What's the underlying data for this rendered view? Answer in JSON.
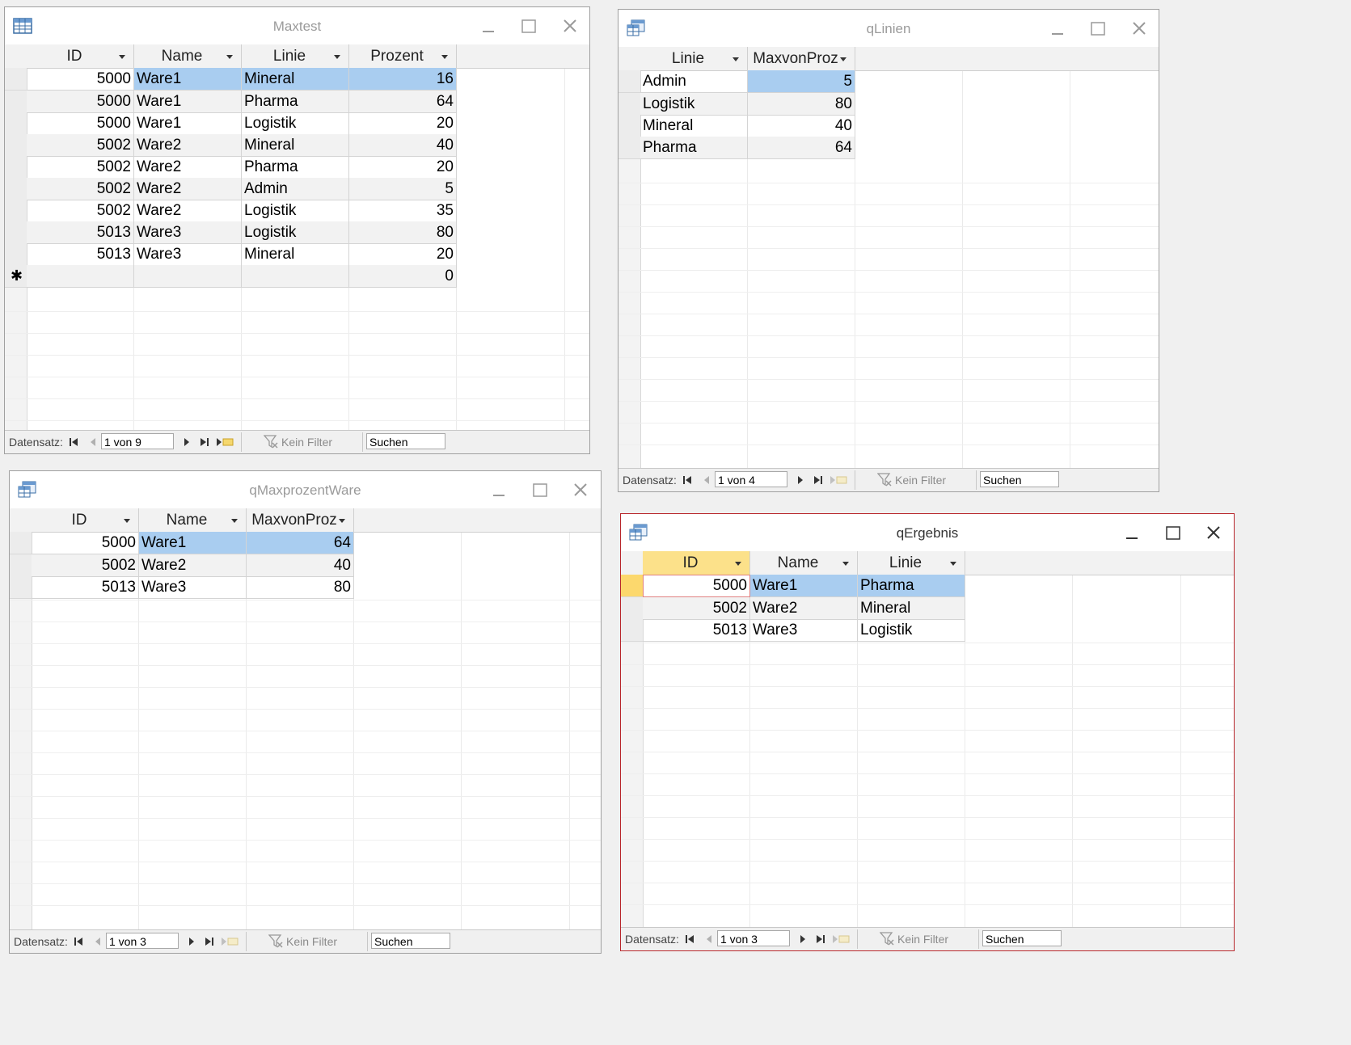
{
  "windows": {
    "maxtest": {
      "title": "Maxtest",
      "columns": [
        "ID",
        "Name",
        "Linie",
        "Prozent"
      ],
      "rows": [
        [
          "5000",
          "Ware1",
          "Mineral",
          "16"
        ],
        [
          "5000",
          "Ware1",
          "Pharma",
          "64"
        ],
        [
          "5000",
          "Ware1",
          "Logistik",
          "20"
        ],
        [
          "5002",
          "Ware2",
          "Mineral",
          "40"
        ],
        [
          "5002",
          "Ware2",
          "Pharma",
          "20"
        ],
        [
          "5002",
          "Ware2",
          "Admin",
          "5"
        ],
        [
          "5002",
          "Ware2",
          "Logistik",
          "35"
        ],
        [
          "5013",
          "Ware3",
          "Logistik",
          "80"
        ],
        [
          "5013",
          "Ware3",
          "Mineral",
          "20"
        ]
      ],
      "new_row_default": "0",
      "status": {
        "label": "Datensatz:",
        "record": "1 von 9",
        "filter": "Kein Filter",
        "search": "Suchen"
      }
    },
    "qlinien": {
      "title": "qLinien",
      "columns": [
        "Linie",
        "MaxvonProz"
      ],
      "rows": [
        [
          "Admin",
          "5"
        ],
        [
          "Logistik",
          "80"
        ],
        [
          "Mineral",
          "40"
        ],
        [
          "Pharma",
          "64"
        ]
      ],
      "status": {
        "label": "Datensatz:",
        "record": "1 von 4",
        "filter": "Kein Filter",
        "search": "Suchen"
      }
    },
    "qmaxprozentware": {
      "title": "qMaxprozentWare",
      "columns": [
        "ID",
        "Name",
        "MaxvonProz"
      ],
      "rows": [
        [
          "5000",
          "Ware1",
          "64"
        ],
        [
          "5002",
          "Ware2",
          "40"
        ],
        [
          "5013",
          "Ware3",
          "80"
        ]
      ],
      "status": {
        "label": "Datensatz:",
        "record": "1 von 3",
        "filter": "Kein Filter",
        "search": "Suchen"
      }
    },
    "qergebnis": {
      "title": "qErgebnis",
      "columns": [
        "ID",
        "Name",
        "Linie"
      ],
      "rows": [
        [
          "5000",
          "Ware1",
          "Pharma"
        ],
        [
          "5002",
          "Ware2",
          "Mineral"
        ],
        [
          "5013",
          "Ware3",
          "Logistik"
        ]
      ],
      "status": {
        "label": "Datensatz:",
        "record": "1 von 3",
        "filter": "Kein Filter",
        "search": "Suchen"
      }
    }
  },
  "colors": {
    "selection": "#a9cdf0",
    "current_record": "#fcd86d",
    "active_border": "#b8272c"
  },
  "icons": {
    "table": "table-icon",
    "query": "query-icon",
    "minimize": "minimize-icon",
    "maximize": "maximize-icon",
    "close": "close-icon"
  }
}
